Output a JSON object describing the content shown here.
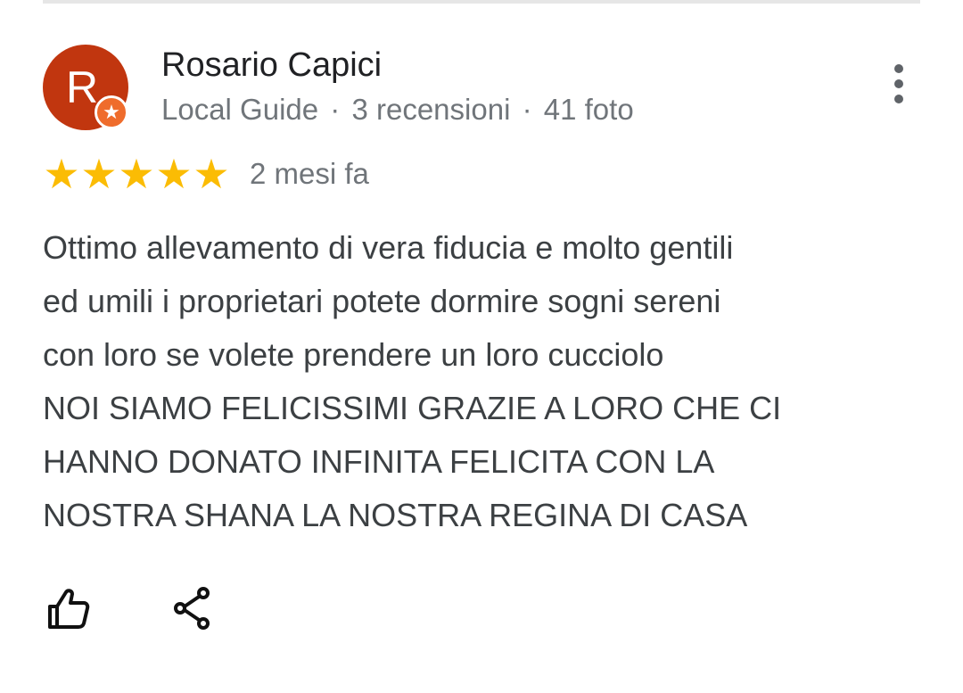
{
  "reviewer": {
    "initial": "R",
    "name": "Rosario Capici",
    "level": "Local Guide",
    "reviews": "3 recensioni",
    "photos": "41 foto",
    "separator": "·"
  },
  "review": {
    "rating": 5,
    "rating_max": 5,
    "date": "2 mesi fa",
    "text_lines": [
      "Ottimo allevamento di vera fiducia e molto gentili",
      "ed umili i proprietari potete dormire sogni sereni",
      "con loro se volete prendere un loro cucciolo",
      "NOI SIAMO FELICISSIMI GRAZIE A LORO CHE CI",
      "HANNO DONATO INFINITA FELICITA CON LA",
      "NOSTRA SHANA LA NOSTRA REGINA DI CASA"
    ]
  },
  "icons": {
    "avatar_badge": "star-icon",
    "menu": "more-vert-icon",
    "like": "thumb-up-icon",
    "share": "share-icon"
  },
  "colors": {
    "avatar": "#c1360f",
    "badge": "#ef6c2c",
    "star": "#fbbc04",
    "secondary_text": "#70757a"
  }
}
